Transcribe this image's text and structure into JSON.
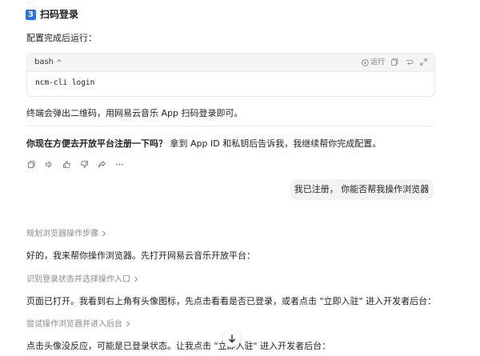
{
  "section": {
    "step_number": "3",
    "title": "扫码登录"
  },
  "intro_text": "配置完成后运行：",
  "code_block": {
    "language": "bash",
    "run_label": "运行",
    "code": "ncm-cli login"
  },
  "after_code_text": "终端会弹出二维码，用网易云音乐 App 扫码登录即可。",
  "question": {
    "bold": "你现在方便去开放平台注册一下吗？",
    "rest": " 拿到 App ID 和私钥后告诉我，我继续帮你完成配置。"
  },
  "message_actions": [
    "copy-icon",
    "speaker-icon",
    "thumbs-up-icon",
    "thumbs-down-icon",
    "share-icon",
    "more-icon"
  ],
  "user_message": "我已注册， 你能否帮我操作浏览器",
  "steps": [
    {
      "label": "规划浏览器操作步骤",
      "result": "好的，我来帮你操作浏览器。先打开网易云音乐开放平台："
    },
    {
      "label": "识别登录状态并选择操作入口",
      "result": "页面已打开。我看到右上角有头像图标，先点击看看是否已登录，或者点击 \"立即入驻\" 进入开发者后台："
    },
    {
      "label": "尝试操作浏览器并进入后台",
      "result": "点击头像没反应，可能是已登录状态。让我点击 \"立即入驻\" 进入开发者后台："
    }
  ],
  "colors": {
    "accent": "#2f6fe6",
    "muted": "#8a8a8f",
    "bubble": "#f2f3f5"
  }
}
